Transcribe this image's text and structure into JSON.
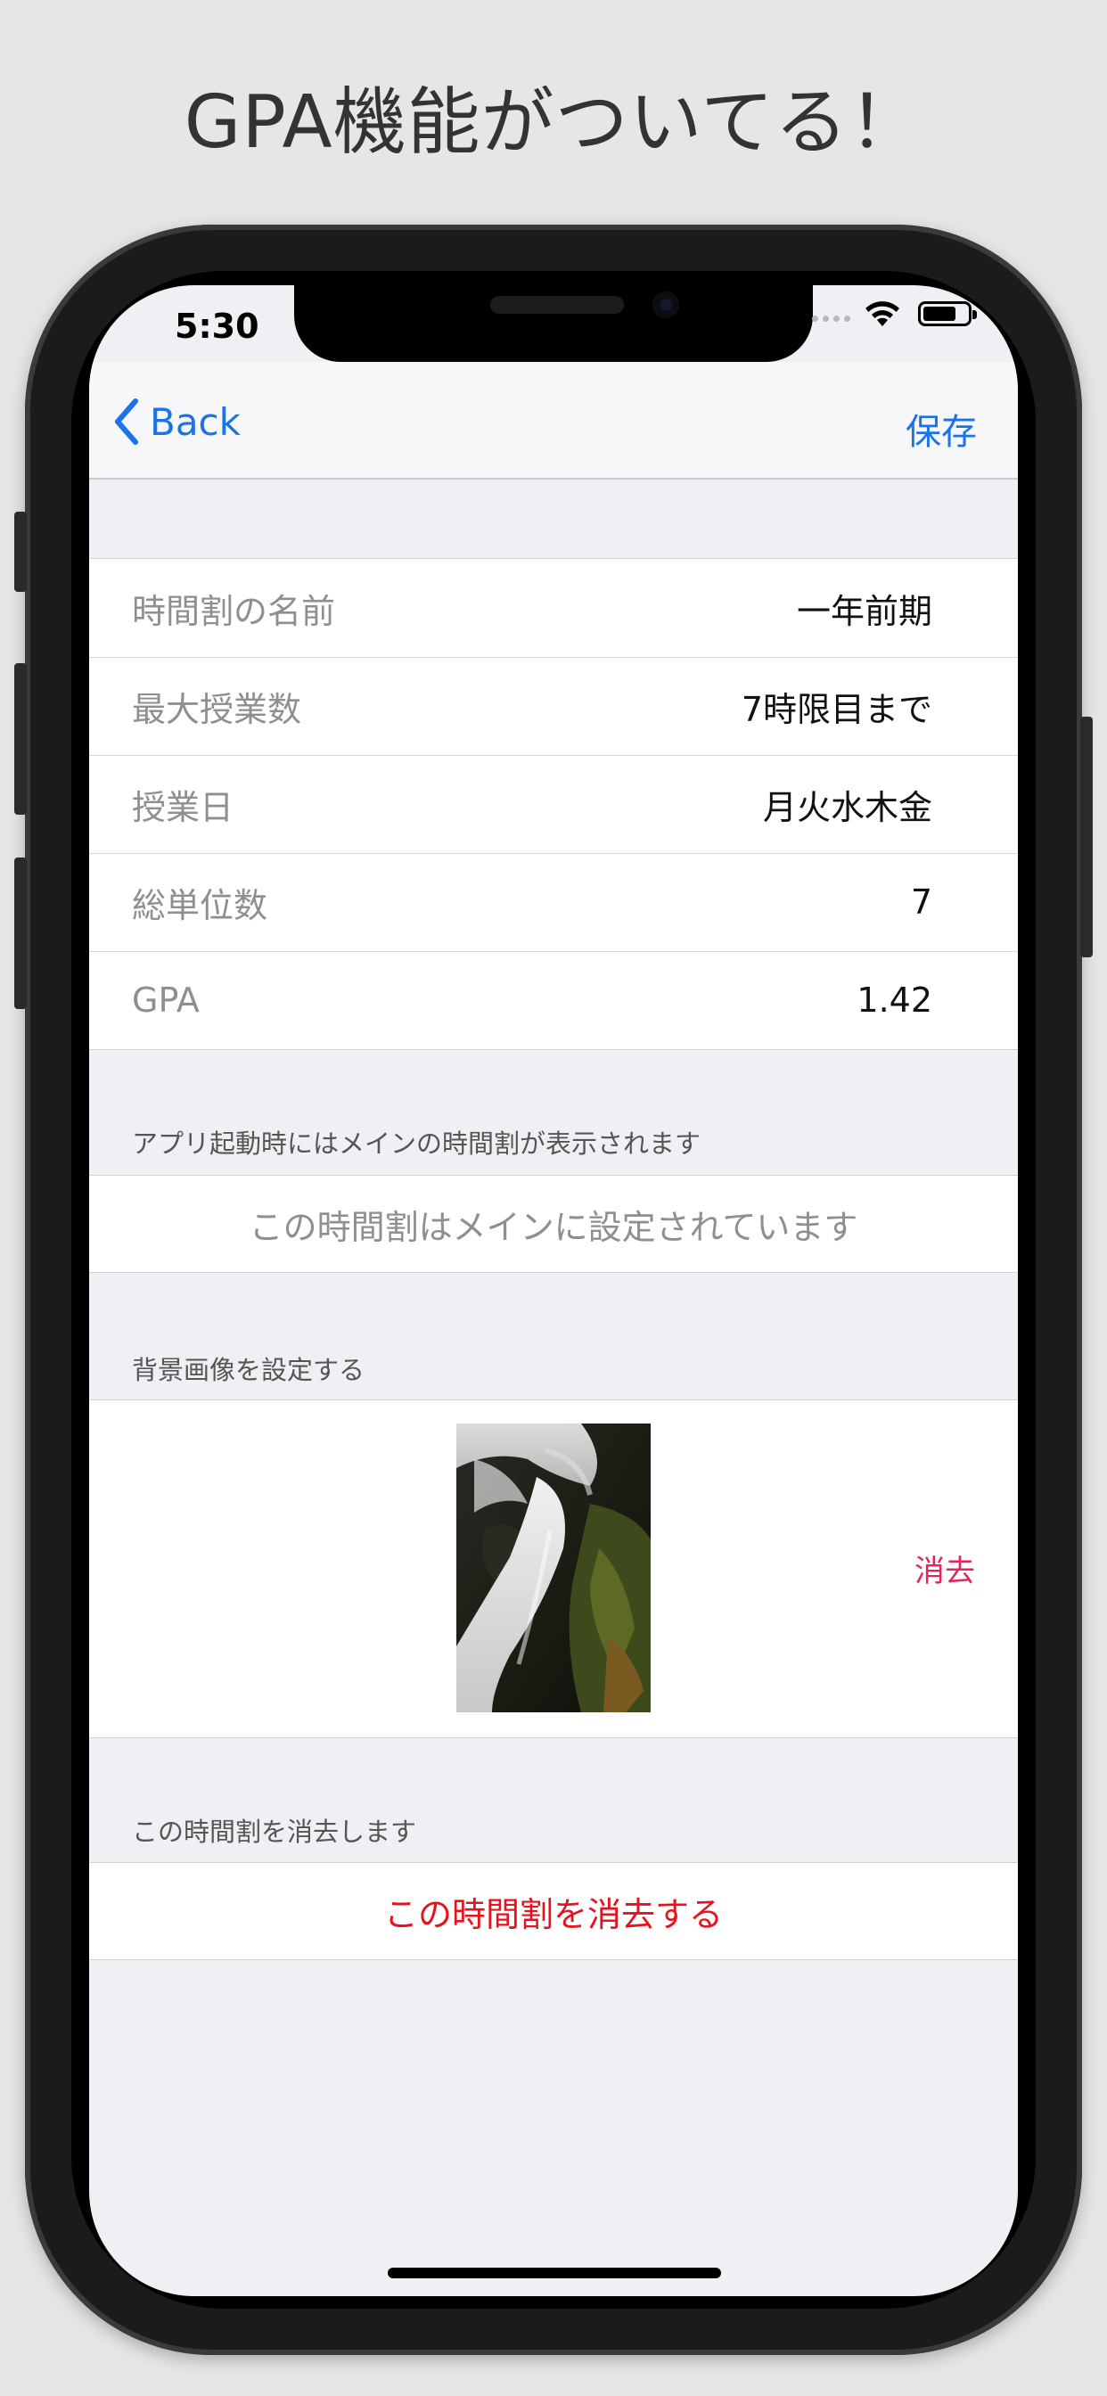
{
  "headline": "GPA機能がついてる！",
  "status_bar": {
    "time": "5:30"
  },
  "navbar": {
    "back_label": "Back",
    "save_label": "保存"
  },
  "settings": {
    "rows": [
      {
        "label": "時間割の名前",
        "value": "一年前期"
      },
      {
        "label": "最大授業数",
        "value": "7時限目まで"
      },
      {
        "label": "授業日",
        "value": "月火水木金"
      },
      {
        "label": "総単位数",
        "value": "7"
      },
      {
        "label": "GPA",
        "value": "1.42"
      }
    ]
  },
  "main_section": {
    "header": "アプリ起動時にはメインの時間割が表示されます",
    "status_text": "この時間割はメインに設定されています"
  },
  "background_section": {
    "header": "背景画像を設定する",
    "delete_label": "消去"
  },
  "delete_section": {
    "header": "この時間割を消去します",
    "button_label": "この時間割を消去する"
  },
  "colors": {
    "accent": "#1a73e8",
    "destructive": "#e3141f",
    "image_delete": "#e6245c",
    "background": "#efeff4"
  }
}
